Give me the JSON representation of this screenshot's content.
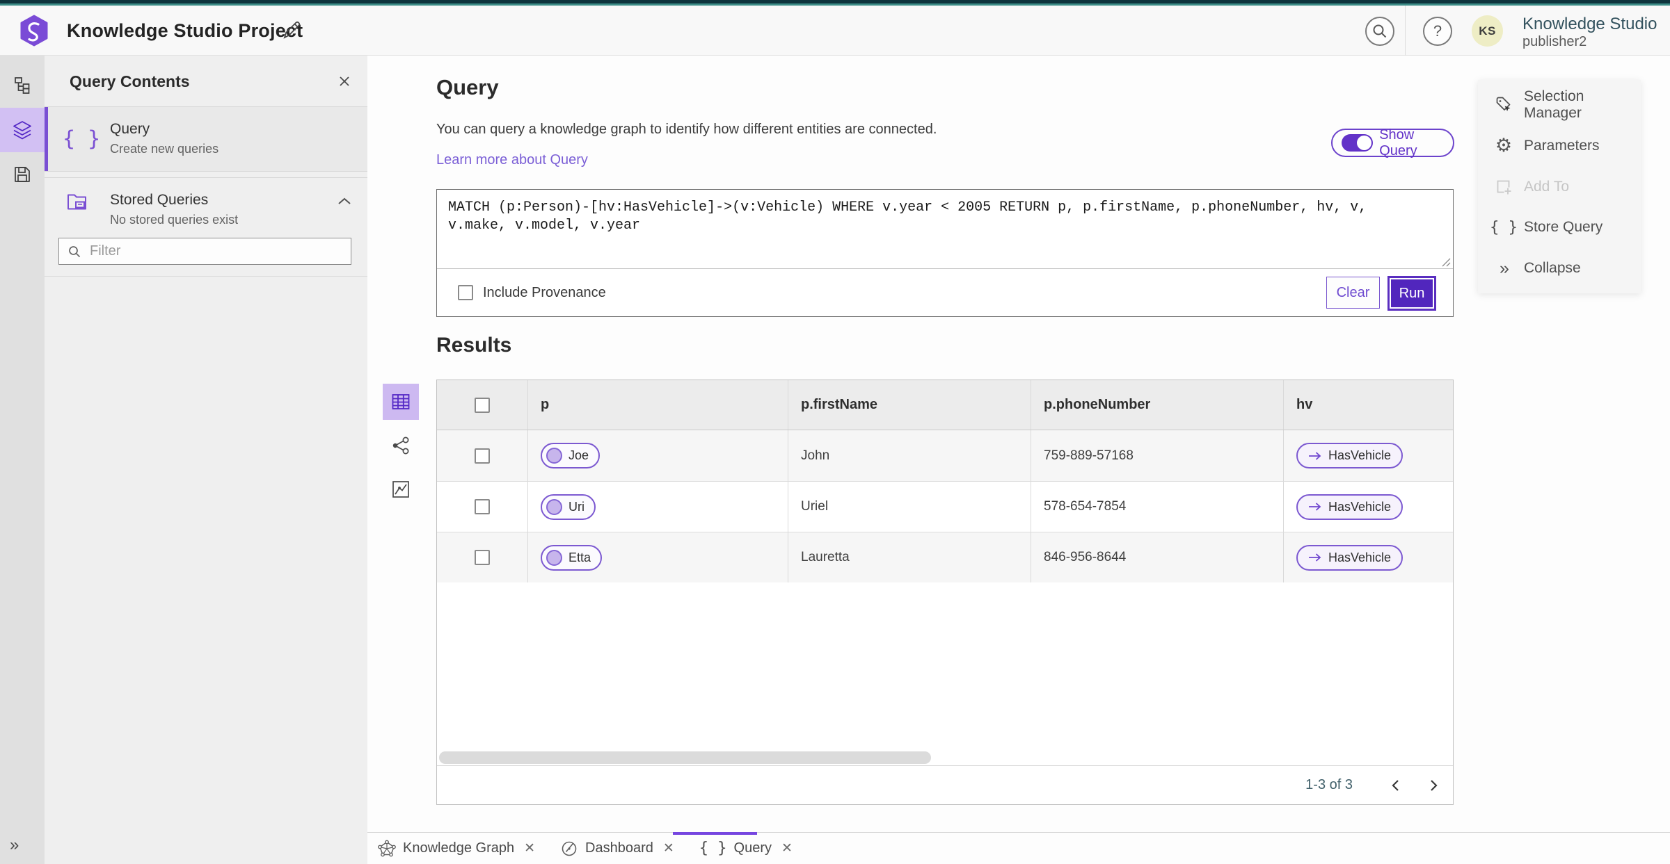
{
  "header": {
    "app_title": "Knowledge Studio Project",
    "search_icon": "search-icon",
    "help_label": "?",
    "user": {
      "initials": "KS",
      "org": "Knowledge Studio",
      "name": "publisher2"
    }
  },
  "left_panel": {
    "title": "Query Contents",
    "items": [
      {
        "icon": "braces-icon",
        "label": "Query",
        "sublabel": "Create new queries",
        "active": true
      },
      {
        "icon": "stored-queries-folder-icon",
        "label": "Stored Queries",
        "sublabel": "No stored queries exist",
        "active": false
      }
    ],
    "filter_placeholder": "Filter"
  },
  "rail": {
    "items": [
      {
        "icon": "hierarchy-icon",
        "active": false
      },
      {
        "icon": "layers-icon",
        "active": true
      },
      {
        "icon": "save-icon",
        "active": false
      }
    ],
    "expand_icon": "double-chevron-right-icon"
  },
  "query_section": {
    "title": "Query",
    "description": "You can query a knowledge graph to identify how different entities are connected.",
    "learn_more": "Learn more about Query",
    "show_query_label": "Show Query",
    "show_query_on": true,
    "query_text": "MATCH (p:Person)-[hv:HasVehicle]->(v:Vehicle) WHERE v.year < 2005 RETURN p, p.firstName, p.phoneNumber, hv, v, v.make, v.model, v.year",
    "include_provenance_label": "Include Provenance",
    "include_provenance_checked": false,
    "clear_label": "Clear",
    "run_label": "Run"
  },
  "results": {
    "title": "Results",
    "view_icons": [
      "table-view-icon",
      "graph-view-icon",
      "chart-view-icon"
    ],
    "active_view": "table",
    "columns": [
      "p",
      "p.firstName",
      "p.phoneNumber",
      "hv"
    ],
    "rows": [
      {
        "entity": "Joe",
        "firstName": "John",
        "phoneNumber": "759-889-57168",
        "relation": "HasVehicle"
      },
      {
        "entity": "Uri",
        "firstName": "Uriel",
        "phoneNumber": "578-654-7854",
        "relation": "HasVehicle"
      },
      {
        "entity": "Etta",
        "firstName": "Lauretta",
        "phoneNumber": "846-956-8644",
        "relation": "HasVehicle"
      }
    ],
    "pagination": {
      "range_label": "1-3 of 3"
    }
  },
  "right_menu": {
    "items": [
      {
        "icon": "selection-manager-icon",
        "label": "Selection Manager",
        "disabled": false
      },
      {
        "icon": "parameters-gear-icon",
        "label": "Parameters",
        "disabled": false
      },
      {
        "icon": "add-to-icon",
        "label": "Add To",
        "disabled": true
      },
      {
        "icon": "store-query-braces-icon",
        "label": "Store Query",
        "disabled": false
      },
      {
        "icon": "collapse-icon",
        "label": "Collapse",
        "disabled": false
      }
    ]
  },
  "bottom_tabs": [
    {
      "icon": "knowledge-graph-icon",
      "label": "Knowledge Graph",
      "active": false
    },
    {
      "icon": "dashboard-gauge-icon",
      "label": "Dashboard",
      "active": false
    },
    {
      "icon": "braces-icon",
      "label": "Query",
      "active": true
    }
  ],
  "colors": {
    "accent_purple": "#6236c9",
    "run_button_purple": "#5126bd",
    "active_light_purple": "#d2c0f3",
    "pill_border_purple": "#7c59d1",
    "link_purple": "#7b5fd6",
    "top_strip_dark": "#0e343d",
    "top_strip_teal": "#3d8d87",
    "user_org_text": "#33525e",
    "avatar_bg": "#eeedc5"
  }
}
